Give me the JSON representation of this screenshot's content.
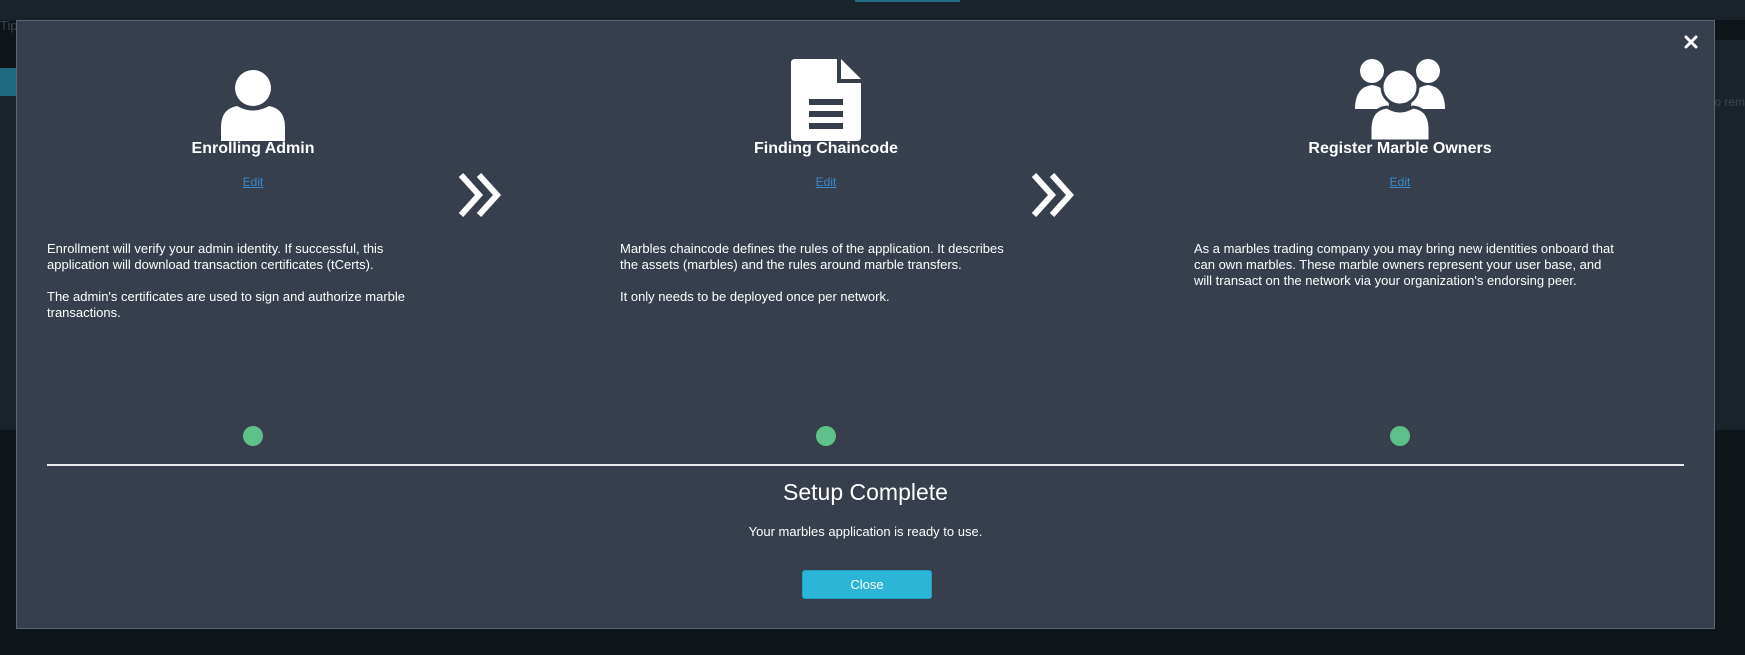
{
  "background": {
    "tip_text": "Tip",
    "right_text": "o rem"
  },
  "modal": {
    "steps": [
      {
        "icon": "user-icon",
        "title": "Enrolling Admin",
        "edit_label": "Edit",
        "paragraphs": [
          "Enrollment will verify your admin identity. If successful, this application will download transaction certificates (tCerts).",
          "The admin's certificates are used to sign and authorize marble transactions."
        ],
        "status_color": "#5ec18a"
      },
      {
        "icon": "document-icon",
        "title": "Finding Chaincode",
        "edit_label": "Edit",
        "paragraphs": [
          "Marbles chaincode defines the rules of the application. It describes the assets (marbles) and the rules around marble transfers.",
          "It only needs to be deployed once per network."
        ],
        "status_color": "#5ec18a"
      },
      {
        "icon": "users-group-icon",
        "title": "Register Marble Owners",
        "edit_label": "Edit",
        "paragraphs": [
          "As a marbles trading company you may bring new identities onboard that can own marbles. These marble owners represent your user base, and will transact on the network via your organization's endorsing peer."
        ],
        "status_color": "#5ec18a"
      }
    ],
    "complete_title": "Setup Complete",
    "complete_subtitle": "Your marbles application is ready to use.",
    "close_button_label": "Close"
  },
  "colors": {
    "modal_bg": "#363f4b",
    "accent_button": "#2bb5d6",
    "status_green": "#5ec18a",
    "link": "#3b8bd0"
  }
}
